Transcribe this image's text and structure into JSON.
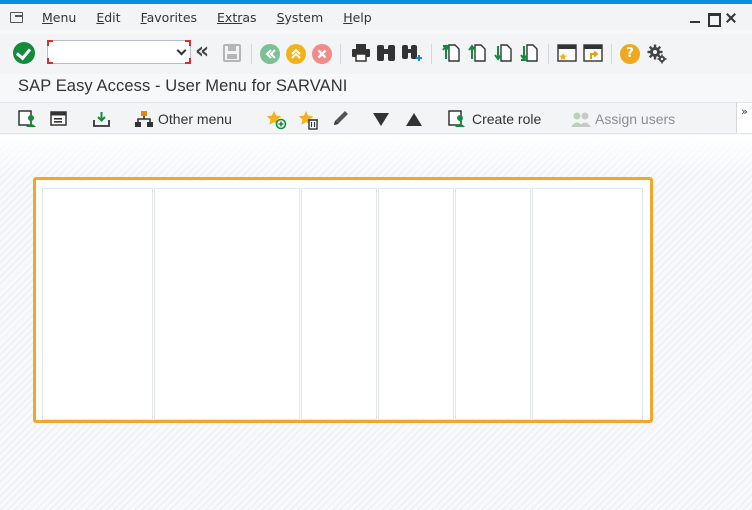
{
  "menubar": {
    "items": [
      {
        "label_u": "M",
        "label_rest": "enu"
      },
      {
        "label_u": "E",
        "label_rest": "dit"
      },
      {
        "label_u": "F",
        "label_rest": "avorites"
      },
      {
        "label_u": "Extr",
        "label_rest": "as"
      },
      {
        "label_u": "S",
        "label_rest": "ystem"
      },
      {
        "label_u": "H",
        "label_rest": "elp"
      }
    ]
  },
  "toolbar": {
    "command_field_value": "",
    "back_glyph": "«"
  },
  "title": "SAP Easy Access  -  User Menu for SARVANI",
  "app_toolbar": {
    "other_menu": "Other menu",
    "create_role": "Create role",
    "assign_users": "Assign users",
    "more": "»"
  },
  "colors": {
    "accent_blue": "#0a8fd8",
    "ok_green": "#148a3c",
    "highlight_orange": "#f4a62a",
    "nav_green": "#7cc196",
    "nav_orange": "#f2b21b",
    "cancel_red": "#f28a8a",
    "help_yellow": "#f0a91d"
  }
}
